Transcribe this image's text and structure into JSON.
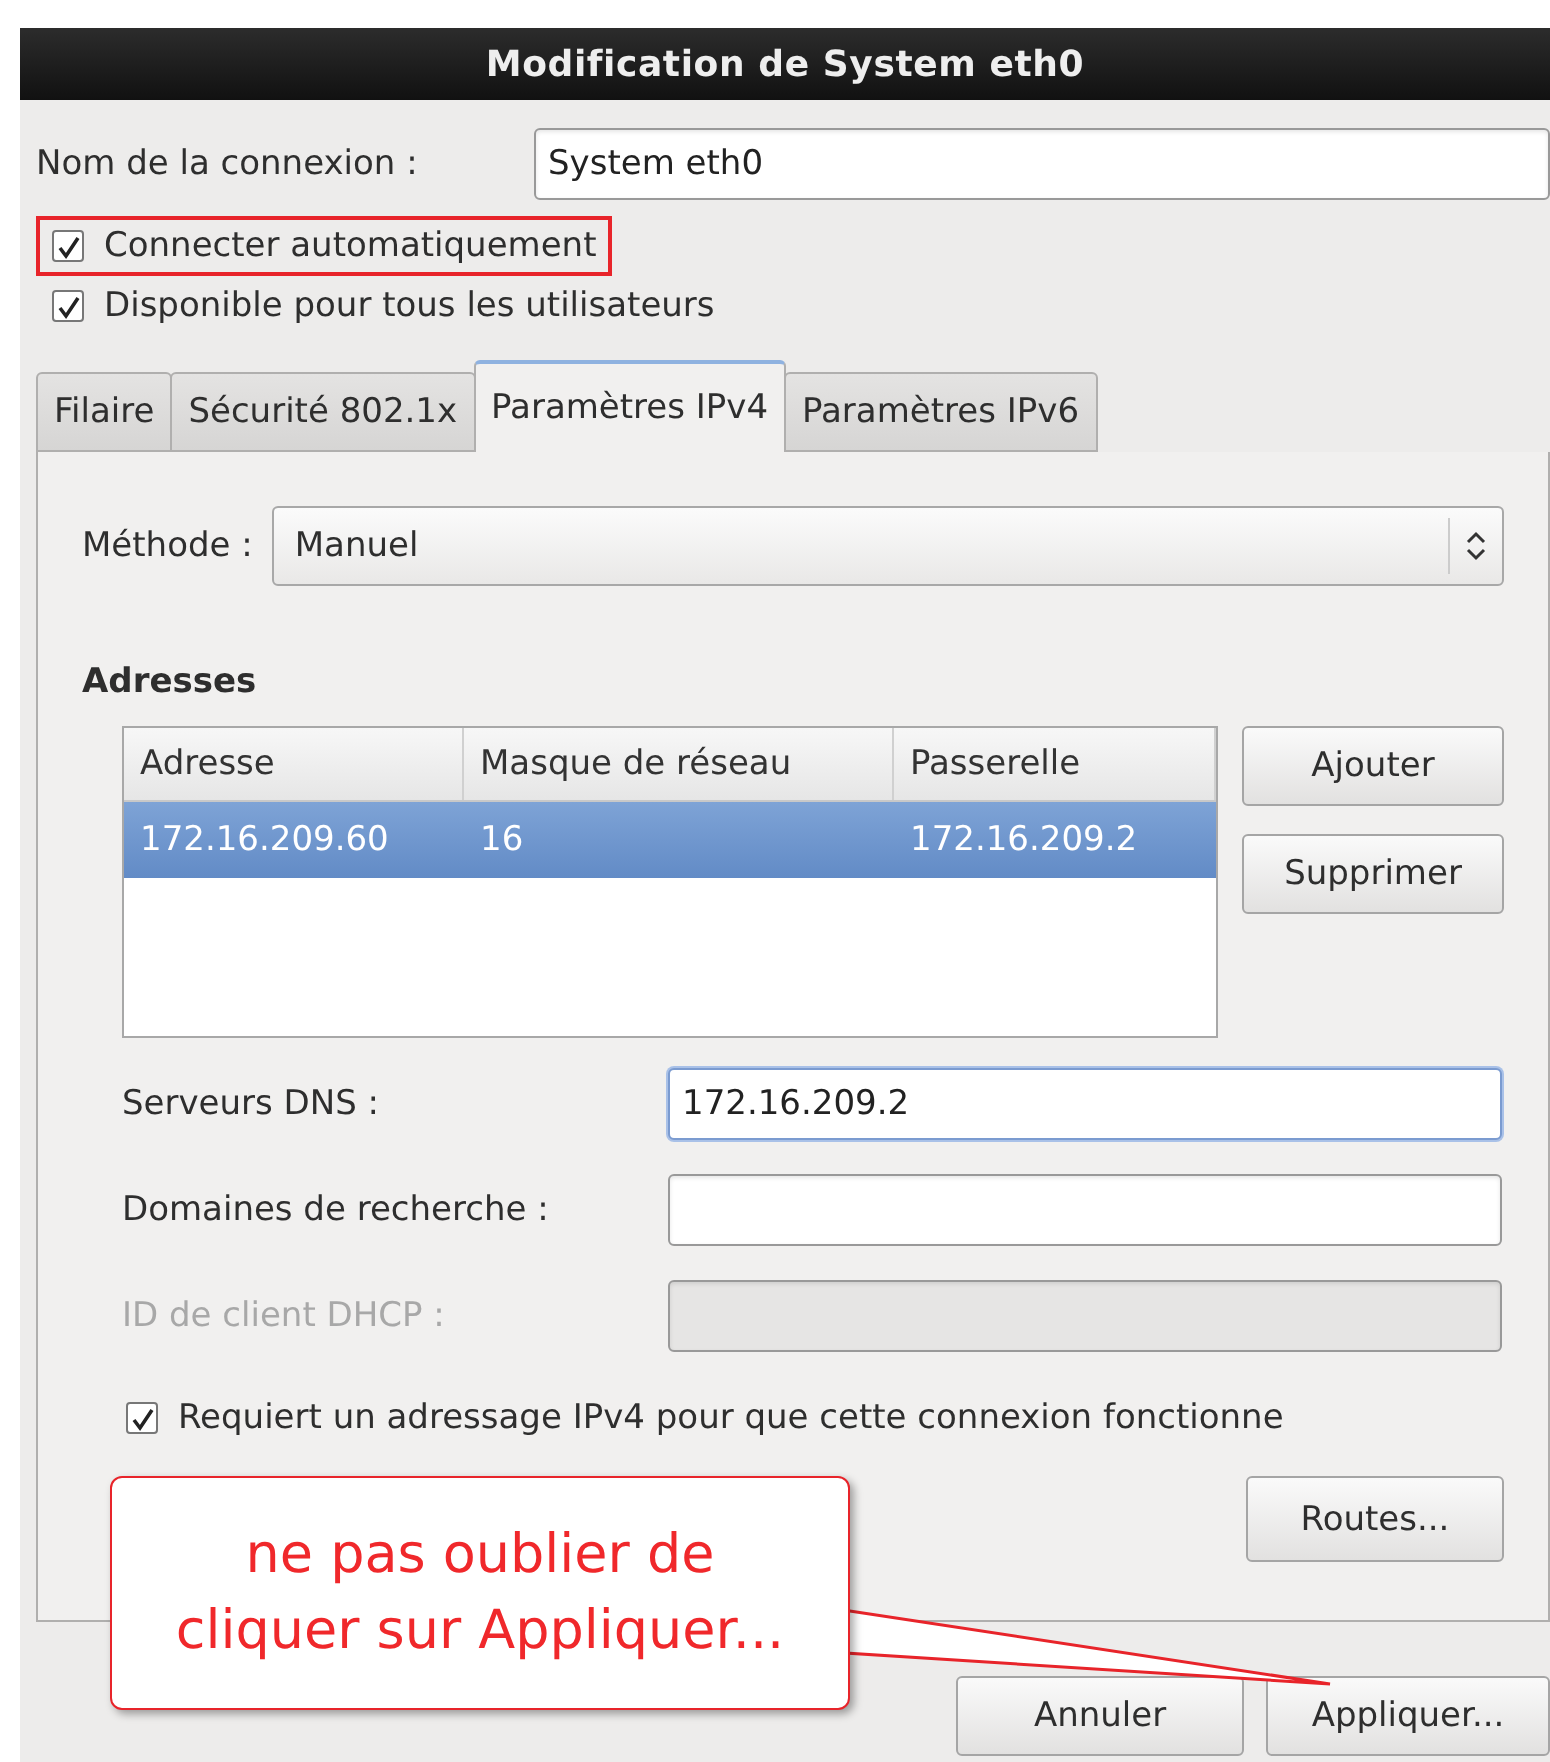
{
  "window": {
    "title": "Modification de System eth0"
  },
  "connection_name": {
    "label": "Nom de la connexion :",
    "value": "System eth0"
  },
  "options": [
    {
      "label": "Connecter automatiquement",
      "checked": true,
      "highlighted": true
    },
    {
      "label": "Disponible pour tous les utilisateurs",
      "checked": true,
      "highlighted": false
    }
  ],
  "tabs": [
    {
      "label": "Filaire",
      "selected": false
    },
    {
      "label": "Sécurité 802.1x",
      "selected": false
    },
    {
      "label": "Paramètres IPv4",
      "selected": true
    },
    {
      "label": "Paramètres IPv6",
      "selected": false
    }
  ],
  "method": {
    "label": "Méthode :",
    "value": "Manuel"
  },
  "addresses": {
    "heading": "Adresses",
    "columns": [
      "Adresse",
      "Masque de réseau",
      "Passerelle"
    ],
    "rows": [
      {
        "cells": [
          "172.16.209.60",
          "16",
          "172.16.209.2"
        ],
        "selected": true
      }
    ],
    "buttons": [
      "Ajouter",
      "Supprimer"
    ]
  },
  "fields": [
    {
      "label": "Serveurs DNS :",
      "value": "172.16.209.2",
      "focused": true,
      "disabled": false
    },
    {
      "label": "Domaines de recherche :",
      "focused": false,
      "disabled": false
    },
    {
      "label": "ID de client DHCP :",
      "focused": false,
      "disabled": true
    }
  ],
  "require_ipv4": {
    "label": "Requiert un adressage IPv4 pour que cette connexion fonctionne",
    "checked": true
  },
  "routes_button": "Routes...",
  "callout": {
    "lines": [
      "ne pas oublier de",
      "cliquer sur Appliquer..."
    ]
  },
  "buttons": [
    "Annuler",
    "Appliquer..."
  ]
}
